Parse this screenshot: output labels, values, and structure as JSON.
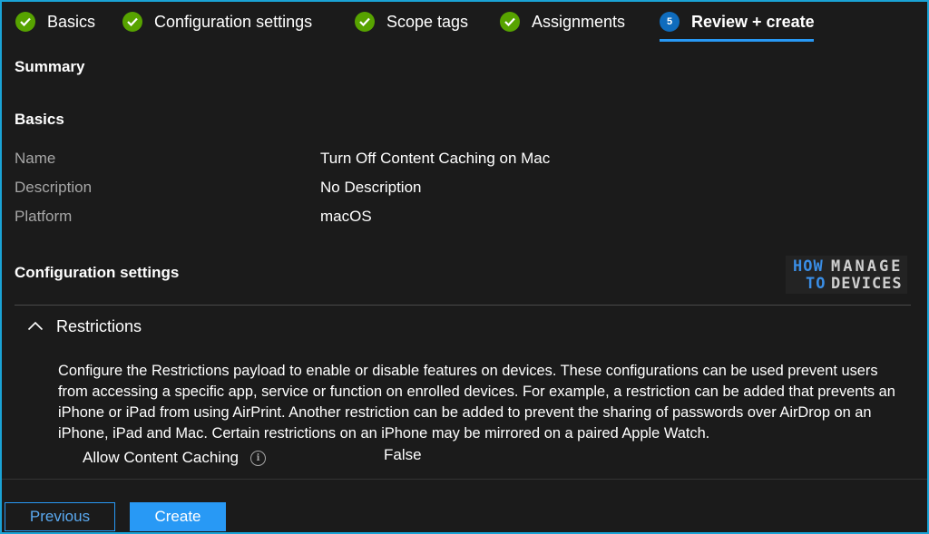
{
  "wizard": {
    "tabs": [
      {
        "label": "Basics",
        "state": "complete",
        "icon": "check-icon"
      },
      {
        "label": "Configuration settings",
        "state": "complete",
        "icon": "check-icon"
      },
      {
        "label": "Scope tags",
        "state": "complete",
        "icon": "check-icon"
      },
      {
        "label": "Assignments",
        "state": "complete",
        "icon": "check-icon"
      },
      {
        "label": "Review + create",
        "state": "active",
        "step": "5"
      }
    ],
    "accent_color": "#2899f5",
    "complete_color": "#57a300"
  },
  "summary": {
    "title": "Summary"
  },
  "basics": {
    "title": "Basics",
    "rows": [
      {
        "label": "Name",
        "value": "Turn Off Content Caching on Mac"
      },
      {
        "label": "Description",
        "value": "No Description"
      },
      {
        "label": "Platform",
        "value": "macOS"
      }
    ]
  },
  "configuration": {
    "title": "Configuration settings",
    "section": {
      "label": "Restrictions",
      "icon": "chevron-up-icon",
      "description": "Configure the Restrictions payload to enable or disable features on devices. These configurations can be used prevent users from accessing a specific app, service or function on enrolled devices. For example, a restriction can be added that prevents an iPhone or iPad from using AirPrint. Another restriction can be added to prevent the sharing of passwords over AirDrop on an iPhone, iPad and Mac. Certain restrictions on an iPhone may be mirrored on a paired Apple Watch.",
      "setting": {
        "label": "Allow Content Caching",
        "icon": "info-icon",
        "value": "False"
      }
    }
  },
  "logo": {
    "how": "HOW",
    "to": "TO",
    "manage": "MANAGE",
    "devices": "DEVICES"
  },
  "footer": {
    "previous_label": "Previous",
    "create_label": "Create"
  }
}
